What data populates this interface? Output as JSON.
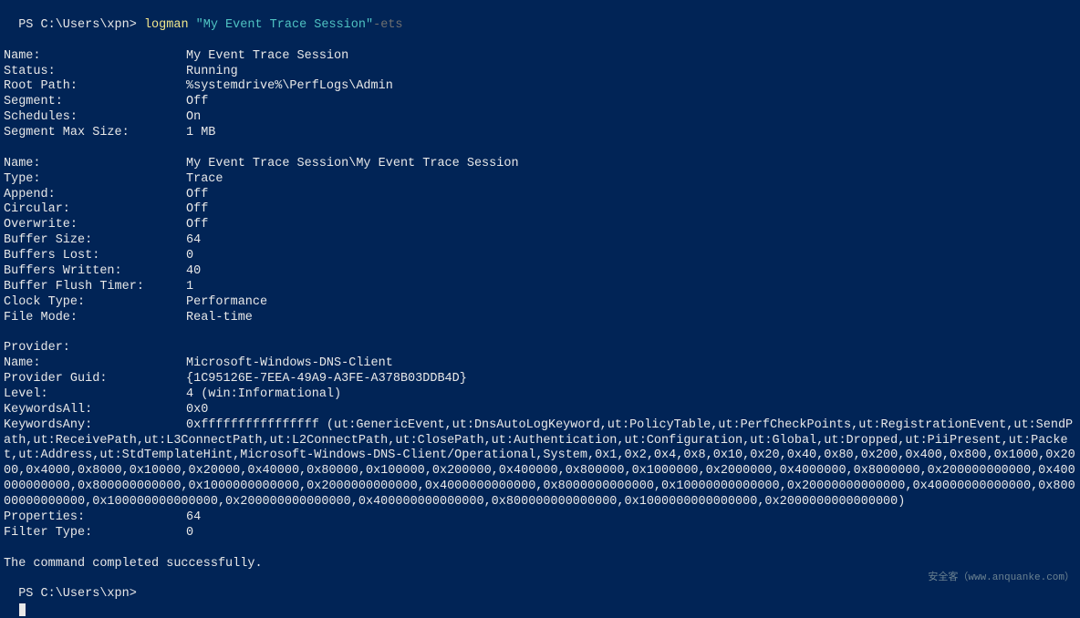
{
  "prompt1": {
    "prefix": "PS C:\\Users\\xpn> ",
    "cmd": "logman ",
    "arg_quoted": "\"My Event Trace Session\"",
    "arg_rest": "-ets"
  },
  "session": [
    {
      "label": "Name:",
      "value": "My Event Trace Session"
    },
    {
      "label": "Status:",
      "value": "Running"
    },
    {
      "label": "Root Path:",
      "value": "%systemdrive%\\PerfLogs\\Admin"
    },
    {
      "label": "Segment:",
      "value": "Off"
    },
    {
      "label": "Schedules:",
      "value": "On"
    },
    {
      "label": "Segment Max Size:",
      "value": "1 MB"
    }
  ],
  "trace": [
    {
      "label": "Name:",
      "value": "My Event Trace Session\\My Event Trace Session"
    },
    {
      "label": "Type:",
      "value": "Trace"
    },
    {
      "label": "Append:",
      "value": "Off"
    },
    {
      "label": "Circular:",
      "value": "Off"
    },
    {
      "label": "Overwrite:",
      "value": "Off"
    },
    {
      "label": "Buffer Size:",
      "value": "64"
    },
    {
      "label": "Buffers Lost:",
      "value": "0"
    },
    {
      "label": "Buffers Written:",
      "value": "40"
    },
    {
      "label": "Buffer Flush Timer:",
      "value": "1"
    },
    {
      "label": "Clock Type:",
      "value": "Performance"
    },
    {
      "label": "File Mode:",
      "value": "Real-time"
    }
  ],
  "provider_header": "Provider:",
  "provider_fixed": [
    {
      "label": "Name:",
      "value": "Microsoft-Windows-DNS-Client"
    },
    {
      "label": "Provider Guid:",
      "value": "{1C95126E-7EEA-49A9-A3FE-A378B03DDB4D}"
    },
    {
      "label": "Level:",
      "value": "4 (win:Informational)"
    },
    {
      "label": "KeywordsAll:",
      "value": "0x0"
    }
  ],
  "keywords_any_label": "KeywordsAny:",
  "keywords_any_value": "0xffffffffffffffff (ut:GenericEvent,ut:DnsAutoLogKeyword,ut:PolicyTable,ut:PerfCheckPoints,ut:RegistrationEvent,ut:SendPath,ut:ReceivePath,ut:L3ConnectPath,ut:L2ConnectPath,ut:ClosePath,ut:Authentication,ut:Configuration,ut:Global,ut:Dropped,ut:PiiPresent,ut:Packet,ut:Address,ut:StdTemplateHint,Microsoft-Windows-DNS-Client/Operational,System,0x1,0x2,0x4,0x8,0x10,0x20,0x40,0x80,0x200,0x400,0x800,0x1000,0x2000,0x4000,0x8000,0x10000,0x20000,0x40000,0x80000,0x100000,0x200000,0x400000,0x800000,0x1000000,0x2000000,0x4000000,0x8000000,0x200000000000,0x400000000000,0x800000000000,0x1000000000000,0x2000000000000,0x4000000000000,0x8000000000000,0x10000000000000,0x20000000000000,0x40000000000000,0x80000000000000,0x100000000000000,0x200000000000000,0x400000000000000,0x800000000000000,0x1000000000000000,0x2000000000000000)",
  "provider_tail": [
    {
      "label": "Properties:",
      "value": "64"
    },
    {
      "label": "Filter Type:",
      "value": "0"
    }
  ],
  "completion": "The command completed successfully.",
  "prompt2": "PS C:\\Users\\xpn>",
  "watermark": "安全客（www.anquanke.com）"
}
